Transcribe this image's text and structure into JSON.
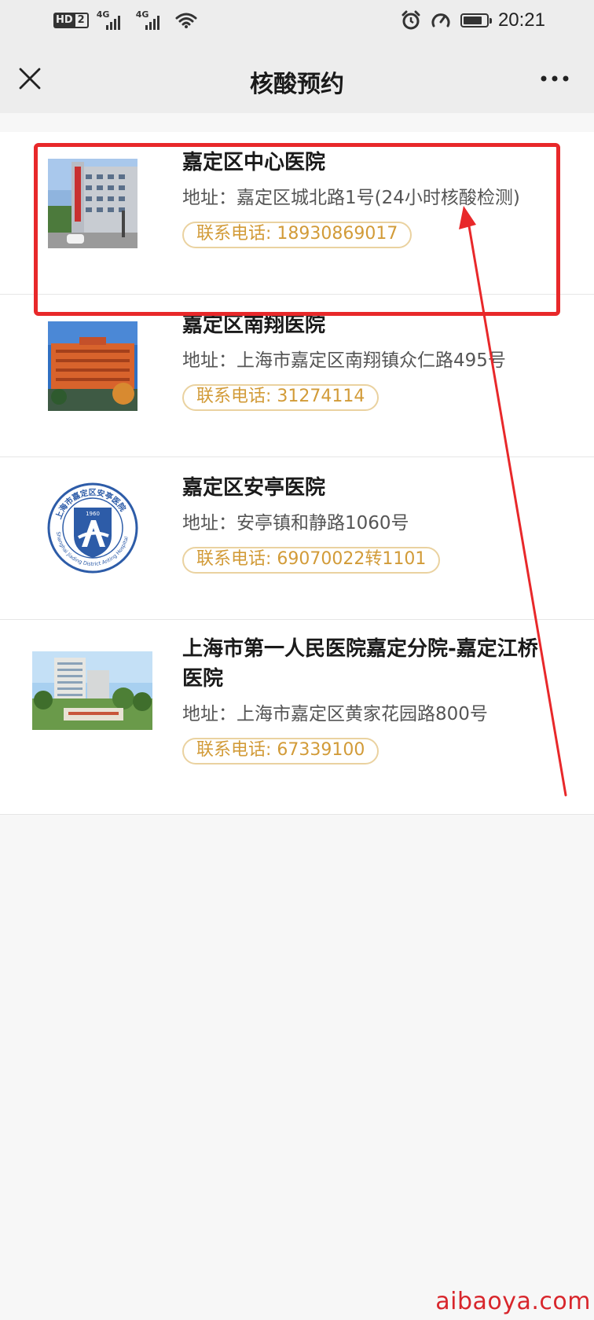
{
  "status_bar": {
    "hd_label": "HD",
    "hd_num": "2",
    "net1": "4G",
    "net2": "4G",
    "time": "20:21",
    "battery_level": 0.85
  },
  "nav": {
    "title": "核酸预约",
    "close_icon": "close-icon",
    "more_icon": "more-icon"
  },
  "hospitals": [
    {
      "name": "嘉定区中心医院",
      "address": "地址：嘉定区城北路1号(24小时核酸检测)",
      "phone": "联系电话: 18930869017"
    },
    {
      "name": "嘉定区南翔医院",
      "address": "地址：上海市嘉定区南翔镇众仁路495号",
      "phone": "联系电话: 31274114"
    },
    {
      "name": "嘉定区安亭医院",
      "address": "地址：安亭镇和静路1060号",
      "phone": "联系电话: 69070022转1101",
      "logo": {
        "ring_text": "上海市嘉定区安亭医院",
        "ring_text_en": "Shanghai Jiading District Anting Hospital",
        "year": "1960"
      }
    },
    {
      "name": "上海市第一人民医院嘉定分院-嘉定江桥医院",
      "address": "地址：上海市嘉定区黄家花园路800号",
      "phone": "联系电话: 67339100"
    }
  ],
  "colors": {
    "annotation_red": "#e8282a",
    "phone_text": "#d29b38",
    "phone_border": "#ead2a0",
    "nav_bg": "#ededed",
    "page_bg": "#f7f7f7"
  },
  "watermark": "aibaoya.com"
}
